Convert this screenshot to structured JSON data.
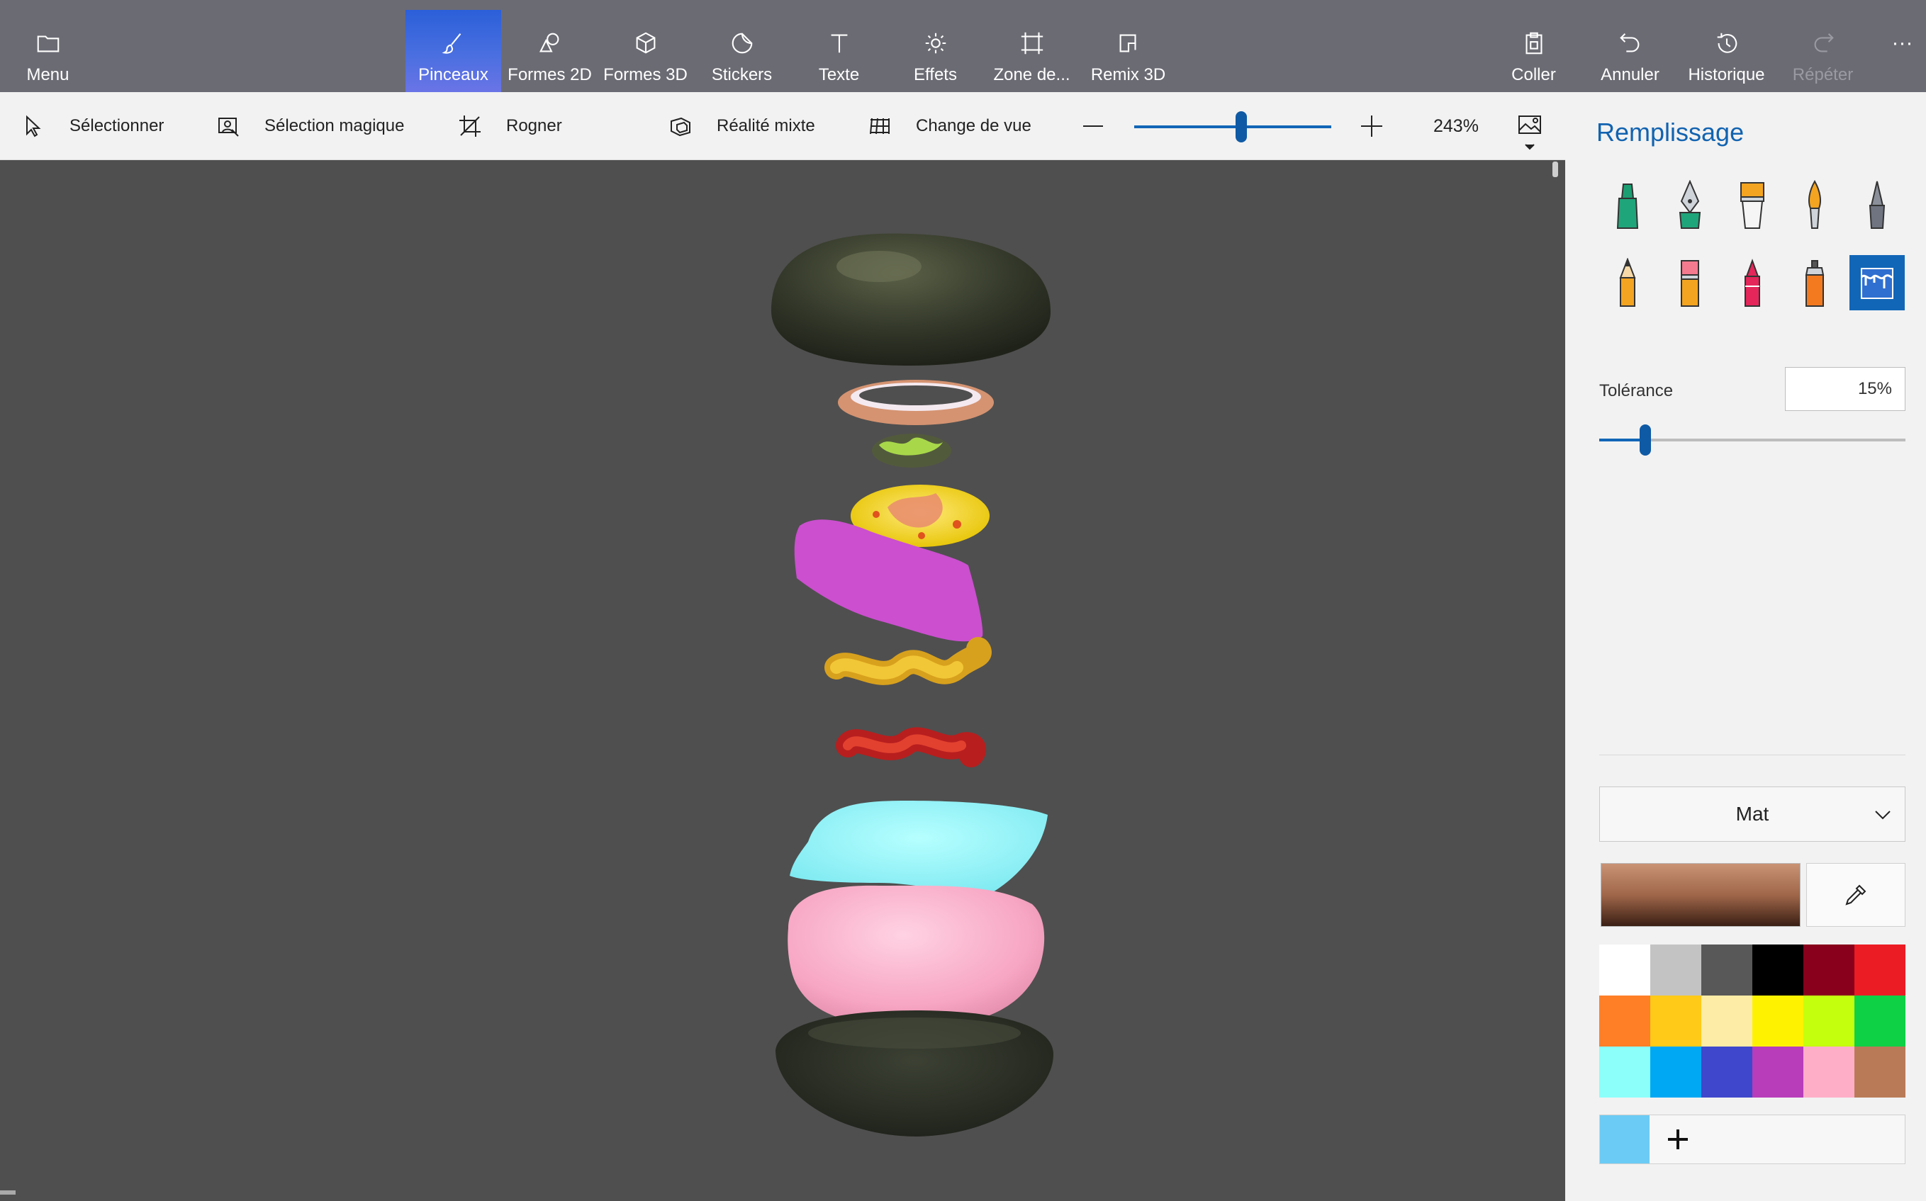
{
  "ribbon": {
    "menu": "Menu",
    "brushes": "Pinceaux",
    "shapes2d": "Formes 2D",
    "shapes3d": "Formes 3D",
    "stickers": "Stickers",
    "text": "Texte",
    "effects": "Effets",
    "canvas": "Zone de...",
    "remix3d": "Remix 3D",
    "paste": "Coller",
    "undo": "Annuler",
    "history": "Historique",
    "redo": "Répéter",
    "more": "···"
  },
  "toolbar": {
    "select": "Sélectionner",
    "magic_select": "Sélection magique",
    "crop": "Rogner",
    "mixed_reality": "Réalité mixte",
    "change_view": "Change de vue",
    "zoom_value": "243%",
    "zoom_level": 243
  },
  "panel": {
    "title": "Remplissage",
    "brushes": [
      "marker-icon",
      "calligraphy-pen-icon",
      "oil-brush-icon",
      "watercolor-icon",
      "pixel-pen-icon",
      "pencil-icon",
      "eraser-icon",
      "crayon-icon",
      "spray-can-icon",
      "fill-bucket-icon"
    ],
    "active_brush": "fill-bucket-icon",
    "tolerance_label": "Tolérance",
    "tolerance_value": "15%",
    "tolerance_level": 0.15,
    "material": "Mat",
    "current_color": "#a0674a",
    "palette": [
      "#ffffff",
      "#c3c3c3",
      "#585858",
      "#000000",
      "#88001b",
      "#ec1c24",
      "#ff7f27",
      "#ffca18",
      "#fdeca6",
      "#fff200",
      "#c4ff0e",
      "#0ed145",
      "#8cfffb",
      "#00a8f3",
      "#3f48cc",
      "#b83dba",
      "#ffaec8",
      "#b97a57"
    ],
    "custom_color": "#6ccbf5",
    "add_color_label": "+"
  },
  "colors": {
    "accent": "#1266b7",
    "ribbon_bg": "#6b6b74",
    "canvas_bg": "#4f4f4f"
  }
}
